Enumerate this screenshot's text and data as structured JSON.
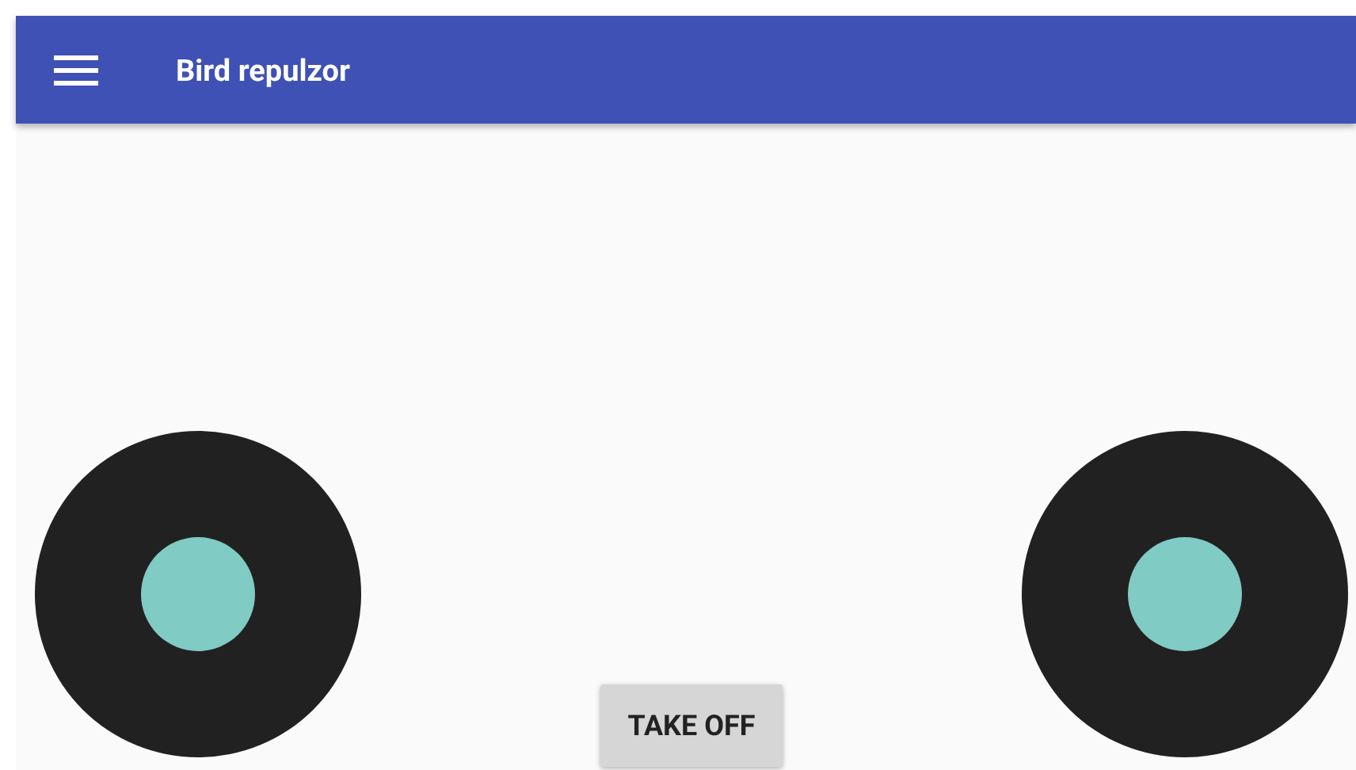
{
  "app_bar": {
    "title": "Bird repulzor"
  },
  "controls": [
    {
      "kind": "joystick"
    },
    {
      "kind": "button",
      "label": "TAKE OFF"
    },
    {
      "kind": "joystick"
    }
  ]
}
